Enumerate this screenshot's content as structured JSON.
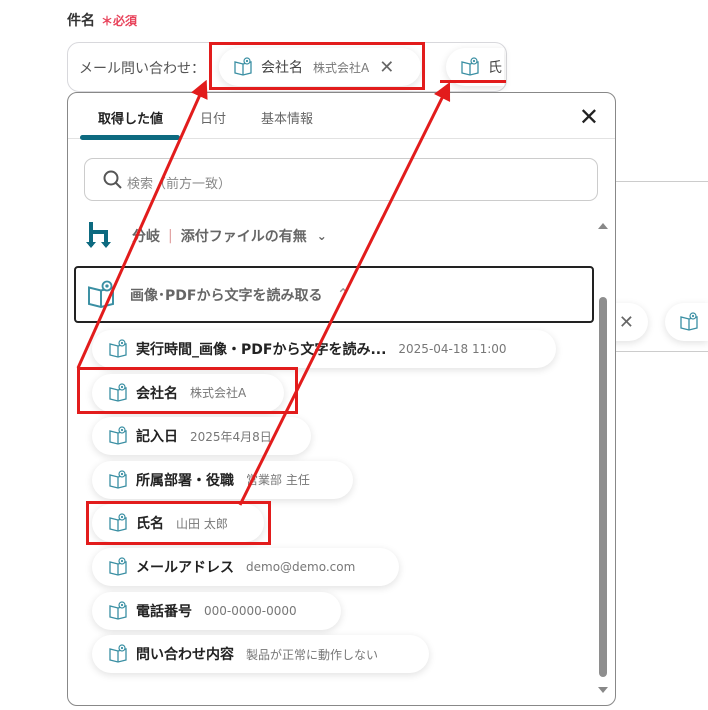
{
  "field": {
    "label": "件名",
    "required_mark": "＊",
    "required_text": "必須",
    "prefix": "メール問い合わせ：",
    "chips": [
      {
        "name": "会社名",
        "value": "株式会社A",
        "remove": "✕"
      },
      {
        "name": "氏"
      }
    ]
  },
  "panel": {
    "tabs": [
      {
        "label": "取得した値"
      },
      {
        "label": "日付"
      },
      {
        "label": "基本情報"
      }
    ],
    "close": "✕",
    "search_placeholder": "検索（前方一致）",
    "branch": {
      "type": "分岐",
      "name": "添付ファイルの有無"
    },
    "section": {
      "title": "画像･PDFから文字を読み取る"
    },
    "items": [
      {
        "name": "実行時間_画像・PDFから文字を読み...",
        "value": "2025-04-18 11:00"
      },
      {
        "name": "会社名",
        "value": "株式会社A"
      },
      {
        "name": "記入日",
        "value": "2025年4月8日"
      },
      {
        "name": "所属部署・役職",
        "value": "営業部 主任"
      },
      {
        "name": "氏名",
        "value": "山田 太郎"
      },
      {
        "name": "メールアドレス",
        "value": "demo@demo.com"
      },
      {
        "name": "電話番号",
        "value": "000-0000-0000"
      },
      {
        "name": "問い合わせ内容",
        "value": "製品が正常に動作しない"
      }
    ]
  },
  "background": {
    "chip_remove": "✕"
  },
  "colors": {
    "accent": "#0d6a80",
    "annotation": "#e21c1c",
    "required": "#e8425a"
  }
}
